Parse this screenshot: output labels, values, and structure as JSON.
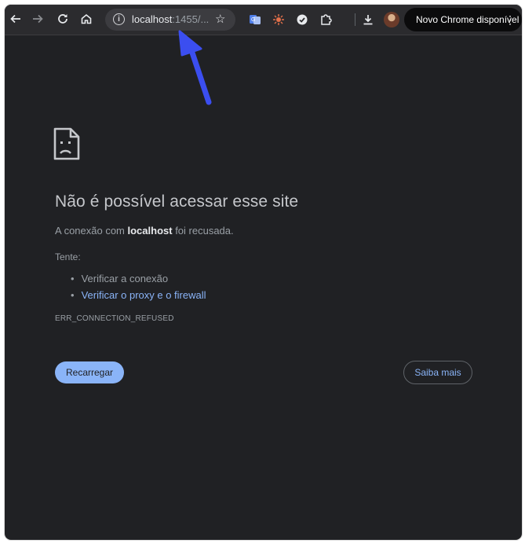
{
  "browser": {
    "address": {
      "host": "localhost",
      "suffix": ":1455/..."
    },
    "update_button": {
      "label": "Novo Chrome disponível",
      "menu_glyph": "⋮"
    },
    "icons": {
      "back": "back-arrow-icon",
      "forward": "forward-arrow-icon",
      "reload": "reload-icon",
      "home": "home-icon",
      "site_info": "info-icon",
      "bookmark": "star-icon",
      "download": "download-icon",
      "extensions": "puzzle-icon"
    }
  },
  "error_page": {
    "icon": "sad-page-icon",
    "title": "Não é possível acessar esse site",
    "description": {
      "before": "A conexão com ",
      "host": "localhost",
      "after": " foi recusada."
    },
    "try_label": "Tente:",
    "suggestions": [
      {
        "text": "Verificar a conexão",
        "is_link": false
      },
      {
        "text": "Verificar o proxy e o firewall",
        "is_link": true
      }
    ],
    "error_code": "ERR_CONNECTION_REFUSED",
    "reload_button": "Recarregar",
    "learn_more_button": "Saiba mais"
  },
  "colors": {
    "page_background": "#202124",
    "toolbar_background": "#2b2b2e",
    "link": "#8ab4f8",
    "primary_button": "#8ab4f8",
    "annotation_arrow": "#3b4ef0"
  }
}
